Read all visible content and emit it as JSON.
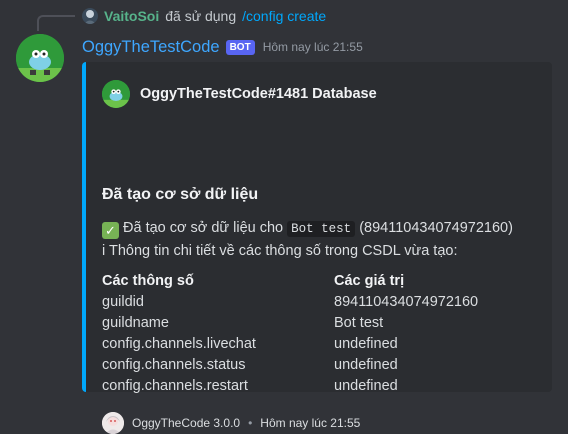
{
  "reply": {
    "username": "VaitoSoi",
    "action": "đã sử dụng",
    "command": "/config create"
  },
  "message": {
    "author": "OggyTheTestCode",
    "bot_tag": "BOT",
    "timestamp": "Hôm nay lúc 21:55"
  },
  "embed": {
    "accent_color": "#00a8fc",
    "author_name": "OggyTheTestCode#1481 Database",
    "title": "Đã tạo cơ sở dữ liệu",
    "desc_line1_pre": "Đã tạo cơ sở dữ liệu cho",
    "desc_line1_code": "Bot test",
    "desc_line1_post": "(894110434074972160)",
    "desc_line2": "i Thông tin chi tiết về các thông số trong CSDL vừa tạo:",
    "fields": [
      {
        "name": "Các thông số",
        "values": [
          "guildid",
          "guildname",
          "config.channels.livechat",
          "config.channels.status",
          "config.channels.restart"
        ]
      },
      {
        "name": "Các giá trị",
        "values": [
          "894110434074972160",
          "Bot test",
          "undefined",
          "undefined",
          "undefined"
        ]
      }
    ],
    "footer_text": "OggyTheCode 3.0.0",
    "footer_separator": "•",
    "footer_time": "Hôm nay lúc 21:55"
  }
}
